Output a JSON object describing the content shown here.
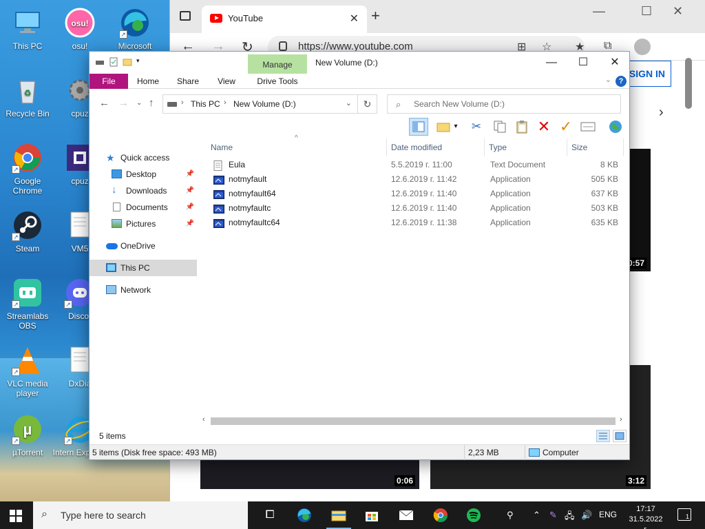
{
  "desktop": {
    "icons": [
      {
        "label": "This PC"
      },
      {
        "label": "Recycle Bin"
      },
      {
        "label": "Google Chrome"
      },
      {
        "label": "Steam"
      },
      {
        "label": "Streamlabs OBS"
      },
      {
        "label": "VLC media player"
      },
      {
        "label": "µTorrent"
      },
      {
        "label": "osu!"
      },
      {
        "label": "cpuz"
      },
      {
        "label": "cpuz"
      },
      {
        "label": "VM5"
      },
      {
        "label": "Discor"
      },
      {
        "label": "DxDia"
      },
      {
        "label": "Intern Explorer"
      },
      {
        "label": "Microsoft"
      }
    ]
  },
  "browser": {
    "tab_title": "YouTube",
    "url": "https://www.youtube.com",
    "sign_in": "SIGN IN",
    "videos": [
      {
        "duration": "0:57"
      },
      {
        "duration": "0:06"
      },
      {
        "duration": "3:12"
      }
    ]
  },
  "explorer": {
    "window_title": "New Volume (D:)",
    "manage_tab": "Manage",
    "ribbon_tabs": [
      "File",
      "Home",
      "Share",
      "View",
      "Drive Tools"
    ],
    "breadcrumb": [
      "This PC",
      "New Volume (D:)"
    ],
    "search_placeholder": "Search New Volume (D:)",
    "nav": {
      "quick_access": "Quick access",
      "desktop": "Desktop",
      "downloads": "Downloads",
      "documents": "Documents",
      "pictures": "Pictures",
      "onedrive": "OneDrive",
      "this_pc": "This PC",
      "network": "Network"
    },
    "columns": [
      "Name",
      "Date modified",
      "Type",
      "Size"
    ],
    "files": [
      {
        "name": "Eula",
        "date": "5.5.2019 г. 11:00",
        "type": "Text Document",
        "size": "8 KB",
        "kind": "text"
      },
      {
        "name": "notmyfault",
        "date": "12.6.2019 г. 11:42",
        "type": "Application",
        "size": "505 KB",
        "kind": "app"
      },
      {
        "name": "notmyfault64",
        "date": "12.6.2019 г. 11:40",
        "type": "Application",
        "size": "637 KB",
        "kind": "app"
      },
      {
        "name": "notmyfaultc",
        "date": "12.6.2019 г. 11:40",
        "type": "Application",
        "size": "503 KB",
        "kind": "app"
      },
      {
        "name": "notmyfaultc64",
        "date": "12.6.2019 г. 11:38",
        "type": "Application",
        "size": "635 KB",
        "kind": "app"
      }
    ],
    "item_count": "5 items",
    "status_free": "5 items (Disk free space: 493 MB)",
    "status_size": "2,23 MB",
    "status_location": "Computer"
  },
  "taskbar": {
    "search_placeholder": "Type here to search",
    "language": "ENG",
    "time": "17:17",
    "date": "31.5.2022 г.",
    "notification_count": "1"
  }
}
